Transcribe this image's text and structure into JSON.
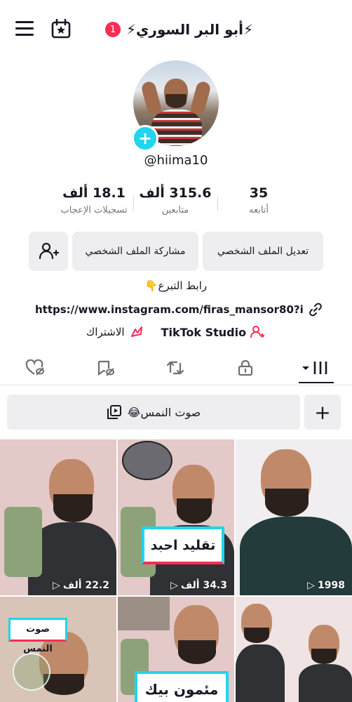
{
  "header": {
    "title": "⚡أبو البر السوري⚡",
    "notification_count": "1",
    "icons": [
      "menu-icon",
      "calendar-star-icon"
    ]
  },
  "profile": {
    "handle": "@hiima10",
    "stats": [
      {
        "value": "18.1 ألف",
        "label": "تسجيلات الإعجاب"
      },
      {
        "value": "315.6 ألف",
        "label": "متابعين"
      },
      {
        "value": "35",
        "label": "أتابعه"
      }
    ],
    "buttons": {
      "edit": "تعديل الملف الشخصي",
      "share": "مشاركة الملف الشخصي"
    },
    "bio": "رابط التبرع👇",
    "link": "https://www.instagram.com/firas_mansor80?ig...",
    "studio": "TikTok Studio",
    "subscribe": "الاشتراك"
  },
  "collection": {
    "chip_label": "صوت النمس😂"
  },
  "videos": [
    {
      "views": "22.2 ألف"
    },
    {
      "views": "34.3 ألف",
      "overlay": "تقليد احبد"
    },
    {
      "views": "1998"
    },
    {
      "overlay": "صوت النمس"
    },
    {
      "overlay": "مئمون بيك"
    },
    {}
  ],
  "colors": {
    "accent": "#fe2c55",
    "avatar_plus": "#20d5ec",
    "button_bg": "#eeeef0"
  }
}
